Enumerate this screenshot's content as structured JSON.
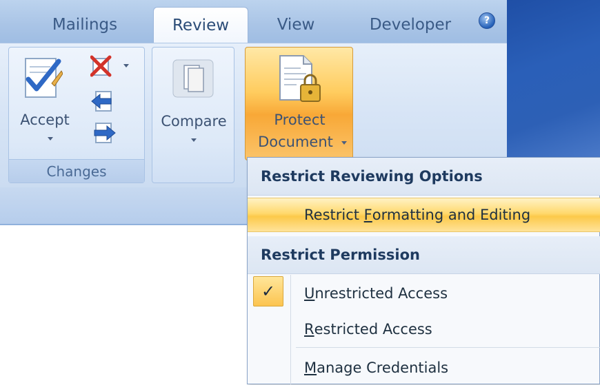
{
  "tabs": [
    {
      "label": "Mailings"
    },
    {
      "label": "Review",
      "active": true
    },
    {
      "label": "View"
    },
    {
      "label": "Developer"
    }
  ],
  "help_icon": "help-icon",
  "ribbon": {
    "changes_group": {
      "label": "Changes",
      "accept_label": "Accept",
      "icons": [
        "accept-check-icon",
        "reject-icon",
        "previous-change-icon",
        "next-change-icon"
      ]
    },
    "compare_group": {
      "compare_label": "Compare",
      "icon": "compare-document-icon"
    },
    "protect": {
      "line1": "Protect",
      "line2": "Document",
      "icon": "document-lock-icon"
    }
  },
  "menu": {
    "section1": "Restrict Reviewing Options",
    "item_formatting": {
      "prefix": "Restrict ",
      "accel": "F",
      "rest": "ormatting and Editing"
    },
    "section2": "Restrict Permission",
    "item_unrestricted": {
      "accel": "U",
      "rest": "nrestricted Access",
      "checked": true
    },
    "item_restricted": {
      "accel": "R",
      "rest": "estricted Access"
    },
    "item_credentials": {
      "accel": "M",
      "rest": "anage Credentials"
    },
    "check_glyph": "✓"
  },
  "colors": {
    "accent_orange": "#f8a837",
    "ribbon_blue": "#d8e5f6",
    "title_dark_blue": "#2a5fb8"
  }
}
